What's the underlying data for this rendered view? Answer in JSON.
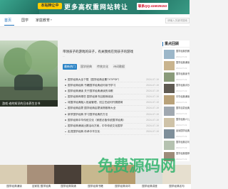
{
  "banner": {
    "tag": "本站转让中",
    "slogan": "更多高权重网站转让",
    "qq": "联系QQ:415025153"
  },
  "nav": {
    "items": [
      "首页",
      "国学",
      "家庭教育"
    ],
    "dropdown_glyph": "▾",
    "search_placeholder": "请输入关键词搜索"
  },
  "hero": {
    "caption": "游戏·老的知识的日本养生古书"
  },
  "topic": {
    "line1": "带领孩子的游戏的日子，有关我找在到孩子的游戏",
    "line2": "…"
  },
  "tabs": [
    {
      "label": "最新热门",
      "active": true
    },
    {
      "label": "国学经典",
      "active": false
    },
    {
      "label": "传统文化",
      "active": false
    },
    {
      "label": "诗词歌赋",
      "active": false
    }
  ],
  "list": [
    {
      "title": "国学经典大全下载（国学经典全集TXT/PDF）",
      "date": "2024-07-19"
    },
    {
      "title": "国学经典经典 书籍国学经典如何读书学习",
      "date": "2024-07-19"
    },
    {
      "title": "国学经典诵读 关于国学经典诵读的诗歌",
      "date": "2024-07-19"
    },
    {
      "title": "国学经典有哪些 国学经典书目推荐阅读",
      "date": "2024-07-19"
    },
    {
      "title": "将国学经典融入班级管理，班主任如何开展德育",
      "date": "2024-07-19"
    },
    {
      "title": "国学经典启蒙 国学经典启蒙读物推荐大全",
      "date": "2024-07-19"
    },
    {
      "title": "新学国学经典 学习国学经典的方法",
      "date": "2024-07-19"
    },
    {
      "title": "国学经典中华传统文化（家庭必备传统国学经典）",
      "date": "2024-07-19"
    },
    {
      "title": "国学经典诵读比赛活动方案，中华传统文化国学",
      "date": "2024-07-19"
    },
    {
      "title": "走进国学经典 传承中华文化",
      "date": "2024-07-19"
    }
  ],
  "side": {
    "heading": "重点回顾",
    "items": [
      {
        "title": "国学经典的朗读",
        "date": "2024-07-19",
        "color": "#9cb7c9"
      },
      {
        "title": "国学经典诵读比赛",
        "date": "2024-07-19",
        "color": "#c9b48e"
      },
      {
        "title": "国学经典读书笔记",
        "date": "2024-07-19",
        "color": "#8a9b7a"
      },
      {
        "title": "国学经典手抄报",
        "date": "2024-07-19",
        "color": "#5f5a52"
      },
      {
        "title": "中华经典诵读",
        "date": "2024-07-19",
        "color": "#b9a27a"
      },
      {
        "title": "国学启蒙经典",
        "date": "2024-07-19",
        "color": "#a0a8b0"
      },
      {
        "title": "国学经典少儿读本",
        "date": "2024-07-19",
        "color": "#cfc3a8"
      },
      {
        "title": "品读国学经典",
        "date": "2024-07-19",
        "color": "#7e8f9a"
      },
      {
        "title": "国学经典名句大全",
        "date": "2024-07-19",
        "color": "#b5c2b0"
      },
      {
        "title": "国学经典推荐",
        "date": "2024-07-19",
        "color": "#9d8c79"
      }
    ]
  },
  "cards": [
    {
      "caption": "国学经典诵读",
      "color": "#d9cdb3"
    },
    {
      "caption": "百家姓·国学经典",
      "color": "#a8907a"
    },
    {
      "caption": "国学经典背诵",
      "color": "#4a4038"
    },
    {
      "caption": "国学经典书籍",
      "color": "#c7b88f"
    },
    {
      "caption": "国学经典诗词",
      "color": "#b69d6e"
    },
    {
      "caption": "国学经典讲座",
      "color": "#d7dcd8"
    },
    {
      "caption": "国学经典名句",
      "color": "#e6dfcf"
    }
  ],
  "watermark": {
    "text": "免费源码网",
    "color": "#2fb36b"
  }
}
